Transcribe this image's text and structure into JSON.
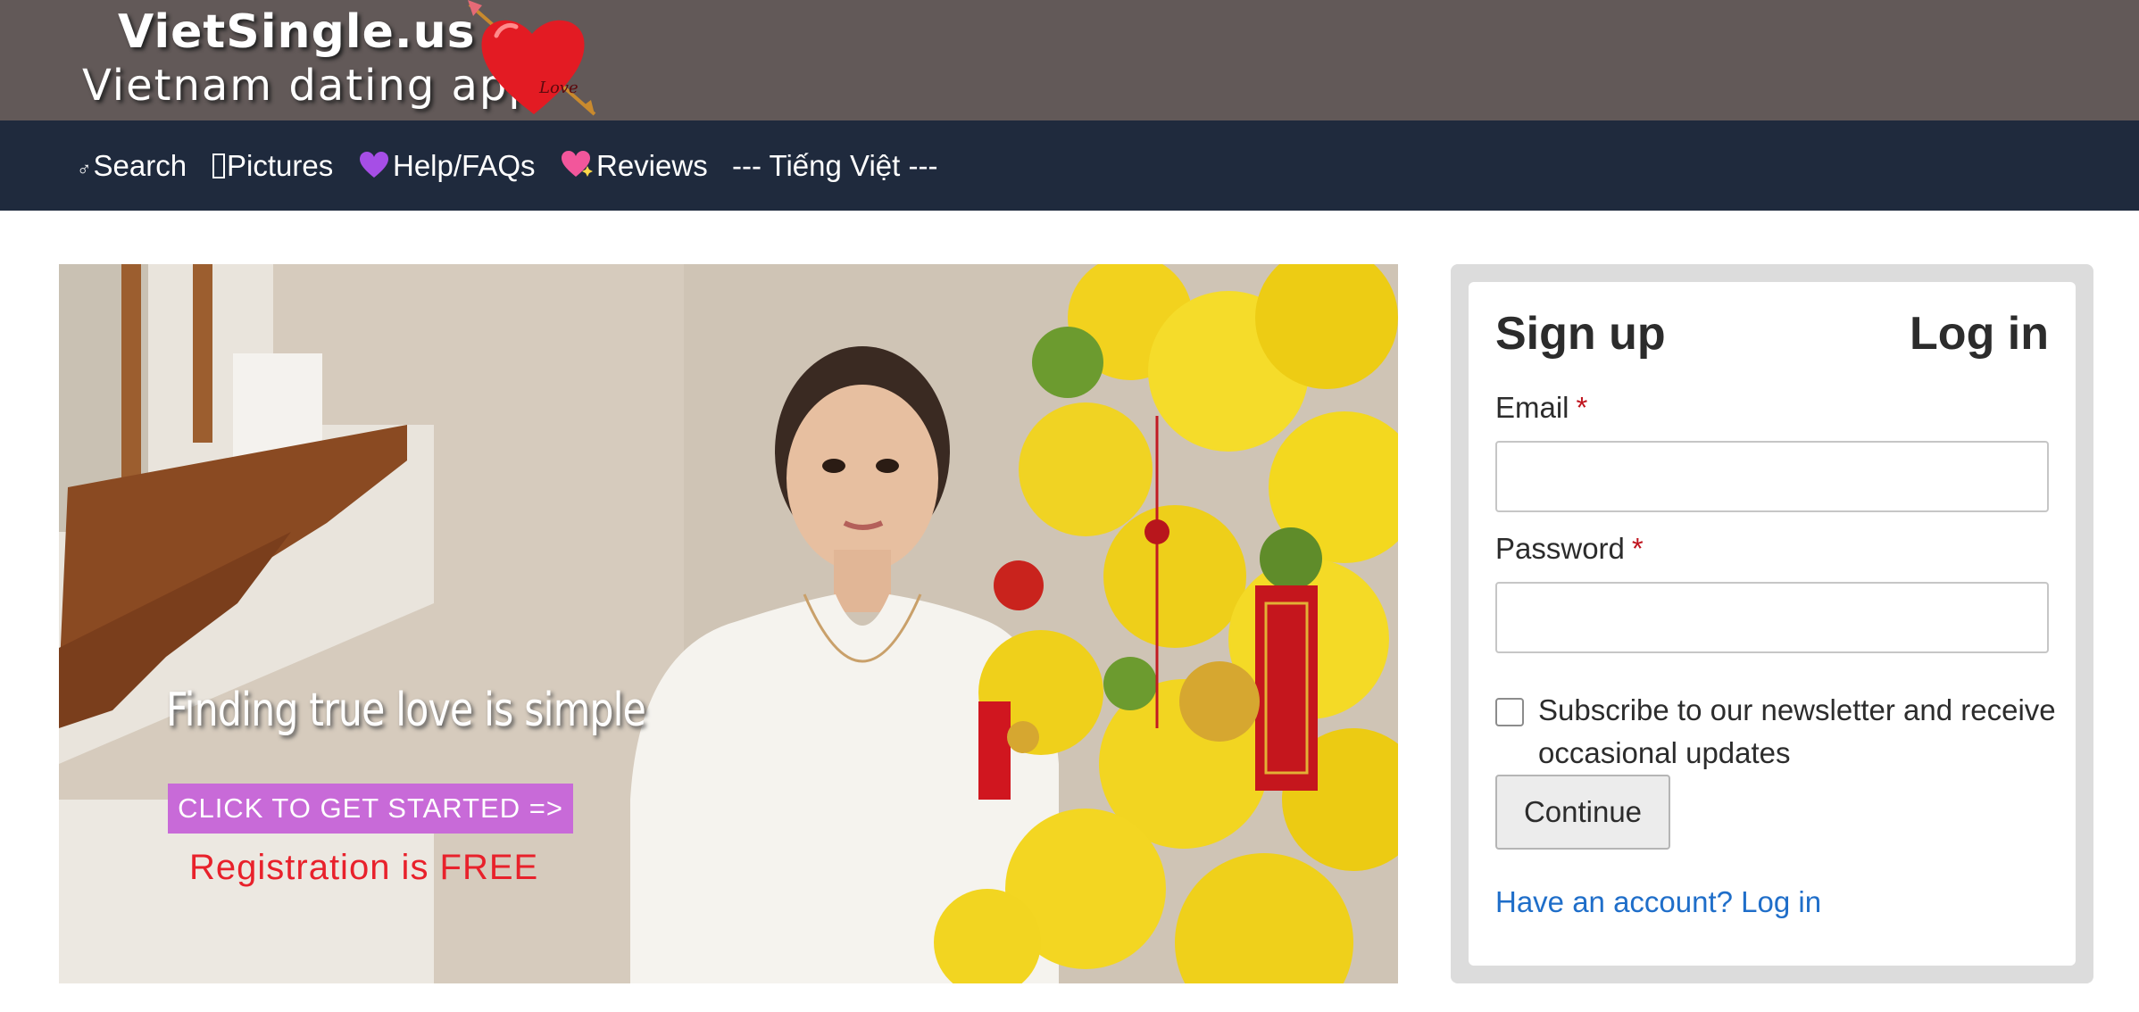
{
  "header": {
    "logo_title": "VietSingle.us",
    "logo_subtitle": "Vietnam dating app",
    "logo_heart_script": "Love",
    "background_color": "#625958"
  },
  "nav": {
    "background_color": "#1f2a3d",
    "items": [
      {
        "icon": "male-symbol-icon",
        "glyph": "♂",
        "label": "Search"
      },
      {
        "icon": "missing-glyph-icon",
        "glyph": "",
        "label": "Pictures"
      },
      {
        "icon": "purple-heart-icon",
        "glyph": "💜",
        "label": "Help/FAQs"
      },
      {
        "icon": "sparkling-heart-icon",
        "glyph": "💖",
        "label": "Reviews"
      },
      {
        "icon": "",
        "glyph": "",
        "label": "--- Tiếng Việt ---"
      }
    ]
  },
  "hero": {
    "tagline": "Finding true love is simple",
    "cta_label": "CLICK TO GET STARTED =>",
    "free_text": "Registration is FREE",
    "cta_color": "#c86ad8",
    "free_color": "#e8212b"
  },
  "signup": {
    "tab_signup": "Sign up",
    "tab_login": "Log in",
    "email_label": "Email",
    "email_value": "",
    "password_label": "Password",
    "password_value": "",
    "required_marker": "*",
    "newsletter_label": "Subscribe to our newsletter and receive occasional updates",
    "newsletter_checked": false,
    "continue_label": "Continue",
    "have_account_link": "Have an account? Log in",
    "link_color": "#1f6ec9"
  }
}
